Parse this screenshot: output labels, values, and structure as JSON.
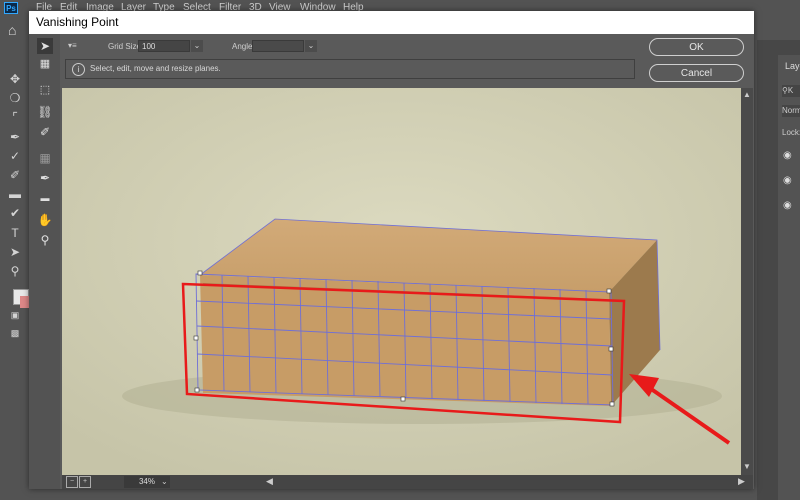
{
  "photoshop": {
    "logo": "Ps",
    "menu": [
      "File",
      "Edit",
      "Image",
      "Layer",
      "Type",
      "Select",
      "Filter",
      "3D",
      "View",
      "Window",
      "Help"
    ],
    "layers_panel_title": "Laye",
    "blend_mode_partial": "Norm",
    "lock_label": "Lock:"
  },
  "dialog": {
    "title": "Vanishing Point",
    "grid_size_label": "Grid Size:",
    "grid_size_value": "100",
    "angle_label": "Angle:",
    "angle_value": "",
    "info_text": "Select, edit, move and resize planes.",
    "ok_label": "OK",
    "cancel_label": "Cancel",
    "zoom_value": "34%"
  },
  "tools": {
    "dialog_tools": [
      "edit-plane-tool-icon",
      "create-plane-tool-icon",
      "marquee-tool-icon",
      "stamp-tool-icon",
      "brush-tool-icon",
      "transform-tool-icon",
      "eyedropper-tool-icon",
      "measure-tool-icon",
      "hand-tool-icon",
      "zoom-tool-icon"
    ]
  },
  "colors": {
    "canvas_background": "#d3d1b6",
    "box": "#c9a06a",
    "grid_line": "#6f6fd6",
    "annotation_red": "#e81a1a"
  }
}
